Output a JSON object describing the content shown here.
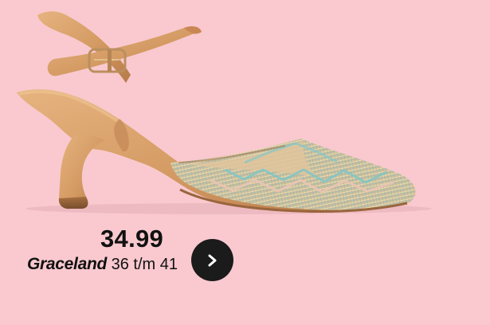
{
  "product": {
    "price": "34.99",
    "brand": "Graceland",
    "size_range": "36 t/m 41",
    "image_icon": "pointed-slingback-heel-image"
  },
  "actions": {
    "next_icon": "chevron-right-icon"
  },
  "colors": {
    "background": "#f9c9cf",
    "shoe_leather": "#d49a63",
    "woven_pattern": "#c7b88a",
    "button": "#1b1b1b",
    "text": "#111111"
  }
}
